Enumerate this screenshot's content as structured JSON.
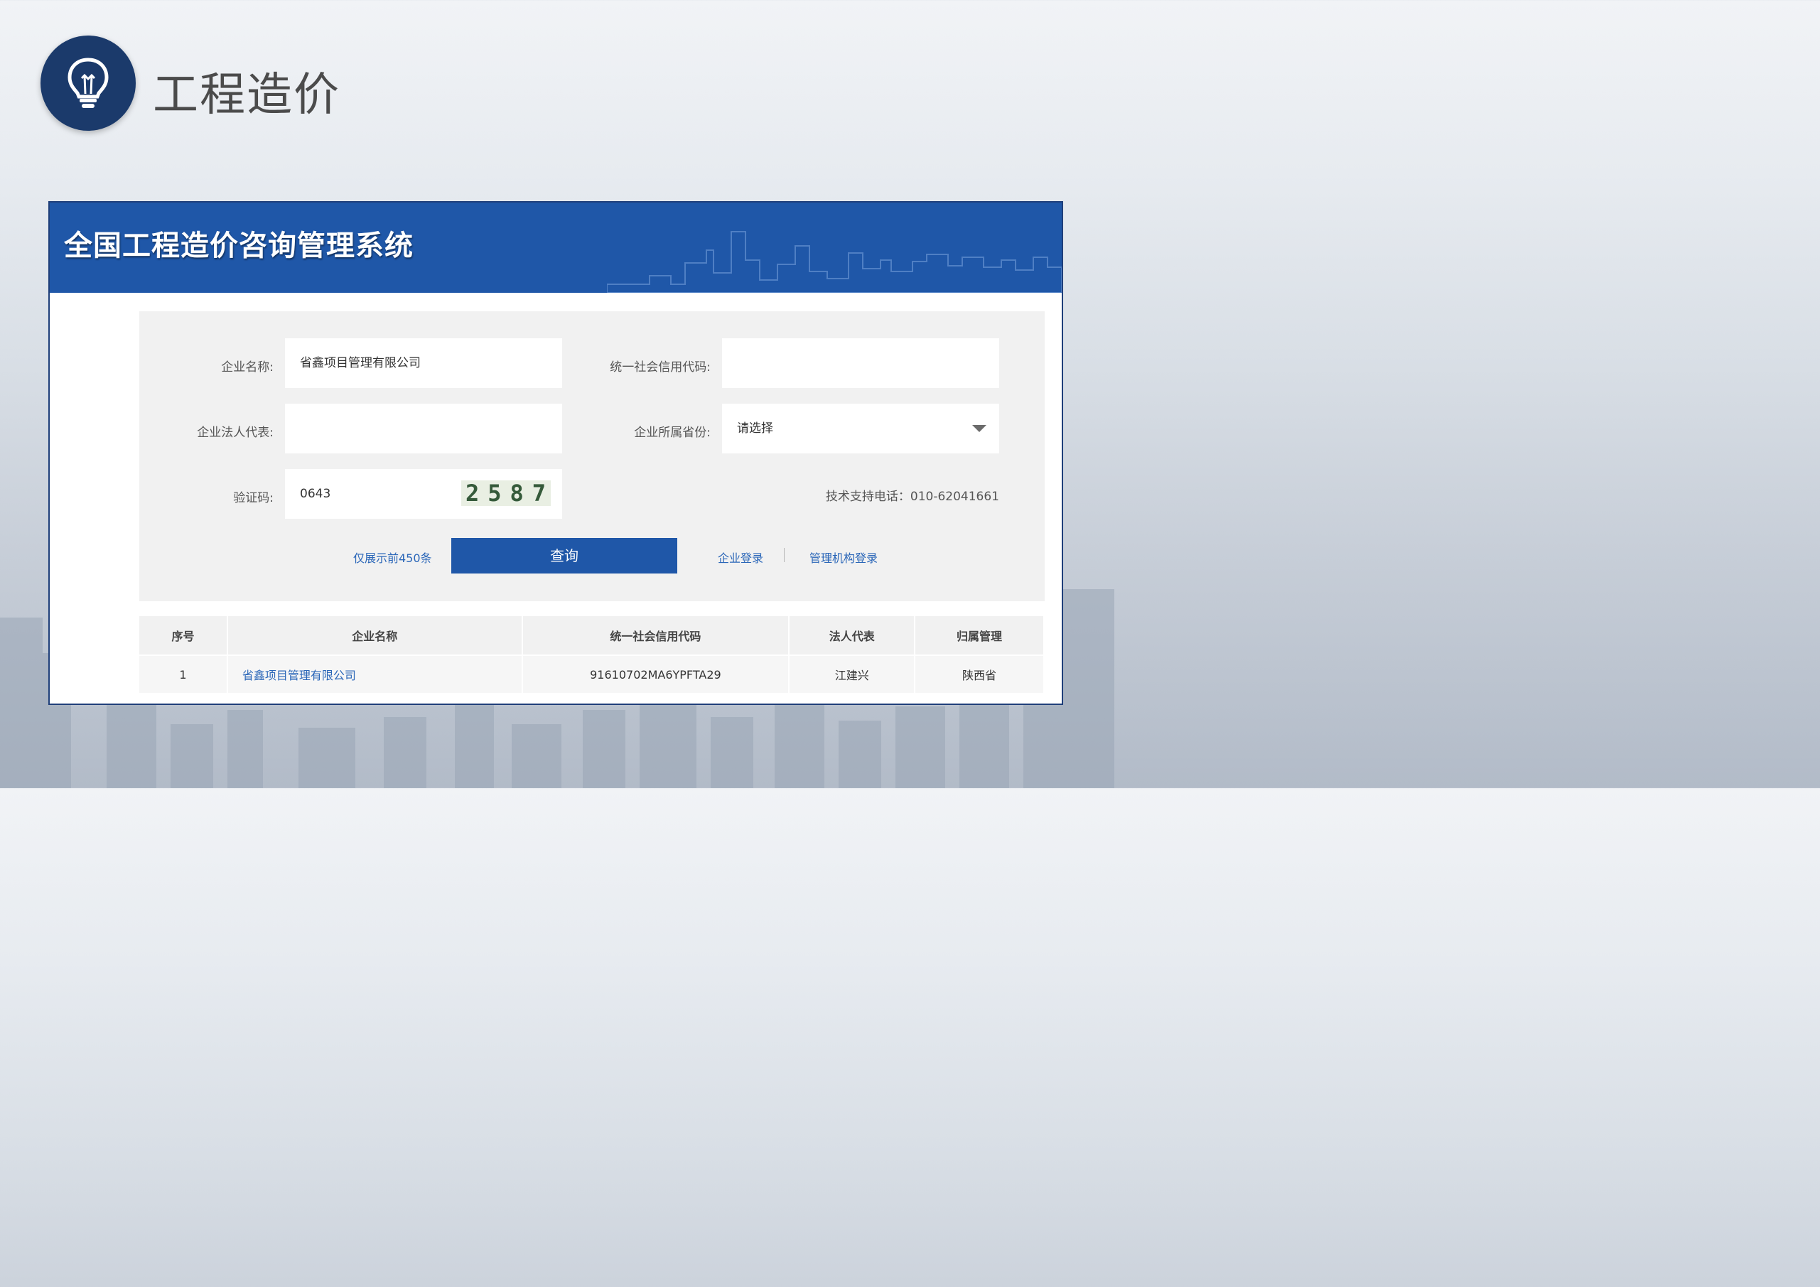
{
  "page": {
    "title": "工程造价"
  },
  "system": {
    "title": "全国工程造价咨询管理系统"
  },
  "form": {
    "company_name_label": "企业名称:",
    "company_name_value": "省鑫项目管理有限公司",
    "credit_code_label": "统一社会信用代码:",
    "credit_code_value": "",
    "legal_rep_label": "企业法人代表:",
    "legal_rep_value": "",
    "province_label": "企业所属省份:",
    "province_value": "请选择",
    "captcha_label": "验证码:",
    "captcha_value": "0643",
    "captcha_image_text": "2587",
    "support_text": "技术支持电话：010-62041661",
    "limit_text": "仅展示前450条",
    "query_label": "查询",
    "enterprise_login": "企业登录",
    "separator": "|",
    "admin_login": "管理机构登录"
  },
  "table": {
    "headers": [
      "序号",
      "企业名称",
      "统一社会信用代码",
      "法人代表",
      "归属管理"
    ],
    "rows": [
      {
        "index": "1",
        "name": "省鑫项目管理有限公司",
        "code": "91610702MA6YPFTA29",
        "rep": "江建兴",
        "region": "陕西省"
      }
    ]
  },
  "colors": {
    "header_blue": "#1f57a8",
    "circle_navy": "#1b3a6b",
    "link_blue": "#2a66b8"
  }
}
